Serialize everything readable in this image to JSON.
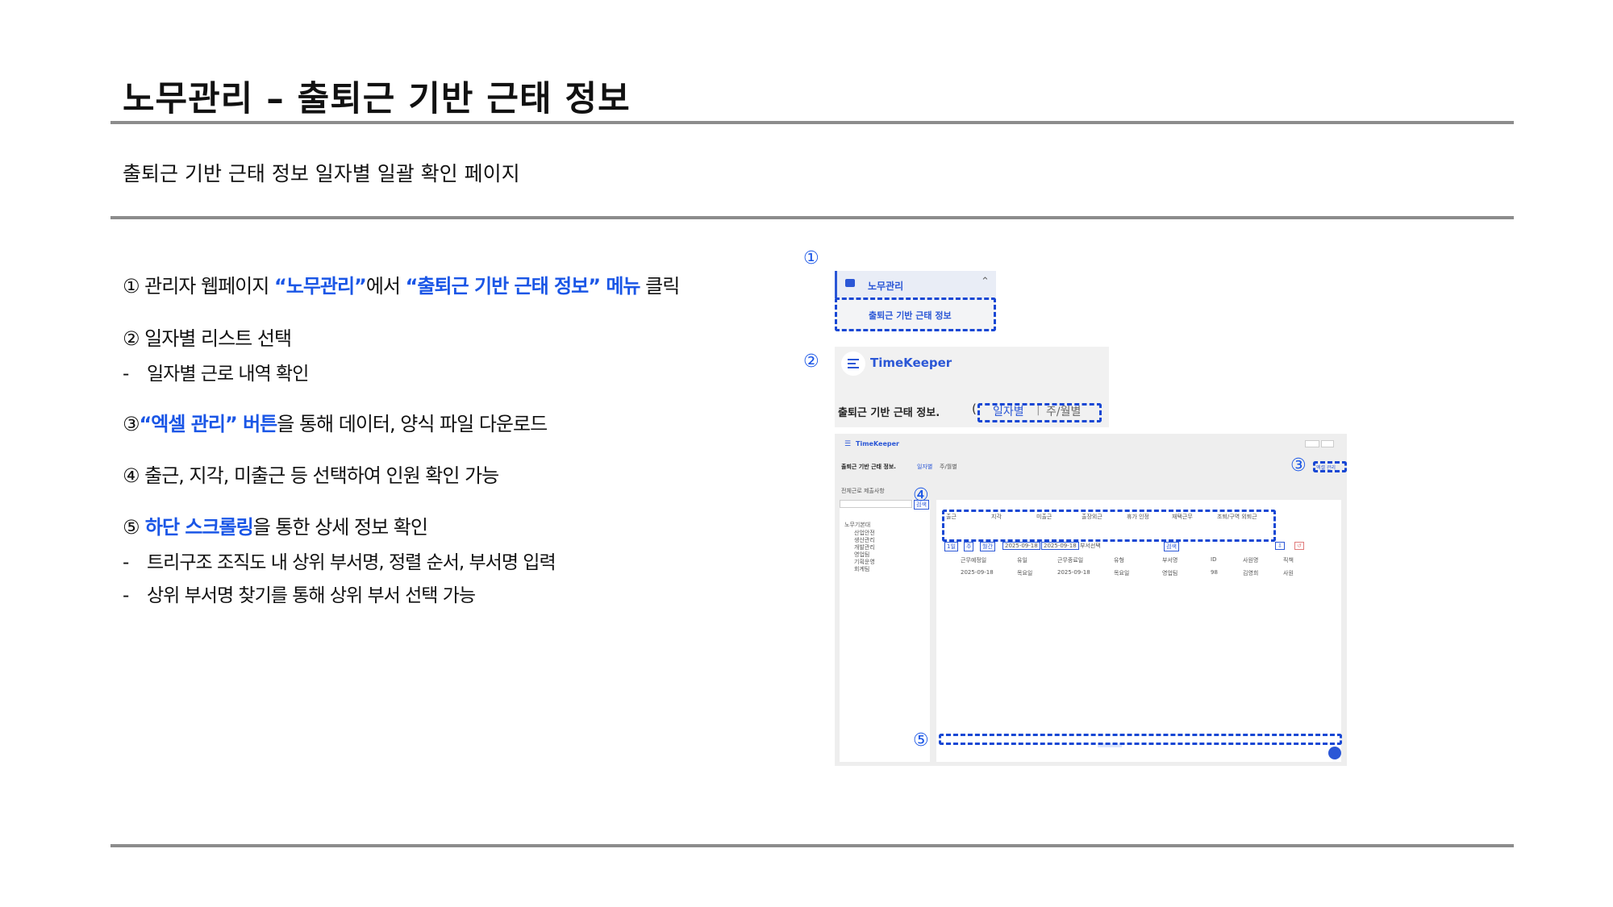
{
  "page": {
    "title": "노무관리 – 출퇴근 기반 근태 정보",
    "subtitle": "출퇴근 기반 근태 정보 일자별 일괄 확인 페이지"
  },
  "steps": {
    "s1": {
      "num": "①",
      "pre": " 관리자 웹페이지 ",
      "hl1": "“노무관리”",
      "mid": "에서 ",
      "hl2": "“출퇴근 기반 근태 정보” 메뉴",
      "post": " 클릭"
    },
    "s2": {
      "num": "②",
      "text": " 일자별 리스트 선택",
      "sub1": "일자별 근로 내역 확인"
    },
    "s3": {
      "num": "③",
      "hl": "“엑셀 관리” 버튼",
      "post": "을 통해 데이터, 양식 파일 다운로드"
    },
    "s4": {
      "num": "④",
      "text": " 출근, 지각, 미출근 등 선택하여 인원 확인 가능"
    },
    "s5": {
      "num": "⑤",
      "hl": " 하단 스크롤링",
      "post": "을 통한 상세 정보 확인",
      "sub1": "트리구조 조직도 내 상위 부서명, 정렬 순서, 부서명 입력",
      "sub2": "상위 부서명 찾기를 통해 상위 부서 선택 가능"
    },
    "dash": "-"
  },
  "markers": {
    "m1": "①",
    "m2": "②",
    "m3": "③",
    "m4": "④",
    "m5": "⑤"
  },
  "panel1": {
    "menu": "노무관리",
    "submenu": "출퇴근 기반 근태 정보"
  },
  "panel2": {
    "app_name": "TimeKeeper",
    "page_name": "출퇴근 기반 근태 정보.",
    "tab_daily": "일자별",
    "tab_weekly": "주/월별"
  },
  "panel3": {
    "app_name": "TimeKeeper",
    "page_name": "출퇴근 기반 근태 정보.",
    "tab_daily": "일자별",
    "tab_weekly": "주/월별",
    "org_label": "전체근로 제출사항",
    "search_btn": "검색",
    "tree": [
      "노무기본대",
      "산업안전",
      "생산관리",
      "개발관리",
      "영업팀",
      "기획운영",
      "회계팀"
    ],
    "stats": [
      "출근",
      "지각",
      "미출근",
      "출장외근",
      "휴가 인정",
      "재택근무",
      "조퇴/구역 외퇴근"
    ],
    "filters": [
      "1일",
      "주",
      "월간",
      "2025-09-18",
      "2025-09-18",
      "부서선택"
    ],
    "excel_btn": "엑셀 관리",
    "table_headers": [
      "근무예정일",
      "유일",
      "근무종료일",
      "유형",
      "부서명",
      "ID",
      "사원명",
      "직책"
    ],
    "table_row": [
      "2025-09-18",
      "목요일",
      "2025-09-18",
      "목요일",
      "영업팀",
      "98",
      "김영희",
      "사원"
    ]
  },
  "colors": {
    "accent": "#1a56e6",
    "rule": "#8c8c8c"
  }
}
